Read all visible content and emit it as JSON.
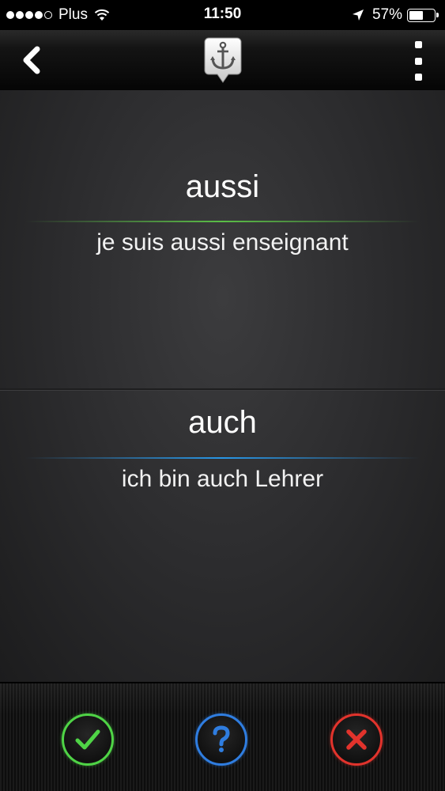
{
  "status_bar": {
    "carrier": "Plus",
    "time": "11:50",
    "battery_percent_label": "57%",
    "battery_level": 0.57,
    "signal_bars_filled": 4,
    "signal_bars_total": 5
  },
  "nav": {
    "back_icon": "chevron-left-icon",
    "logo_icon": "anchor-icon",
    "menu_icon": "more-vertical-icon"
  },
  "card": {
    "front": {
      "term": "aussi",
      "example": "je suis aussi enseignant"
    },
    "back": {
      "term": "auch",
      "example": "ich bin auch Lehrer"
    }
  },
  "toolbar": {
    "buttons": [
      {
        "name": "correct",
        "icon": "checkmark-icon",
        "color": "#4fd446"
      },
      {
        "name": "hint",
        "icon": "question-mark-icon",
        "color": "#2f7de0"
      },
      {
        "name": "wrong",
        "icon": "close-x-icon",
        "color": "#e2332c"
      }
    ]
  },
  "colors": {
    "accent_green": "#5abe46",
    "accent_blue": "#2896e6",
    "accent_red": "#e2332c"
  }
}
